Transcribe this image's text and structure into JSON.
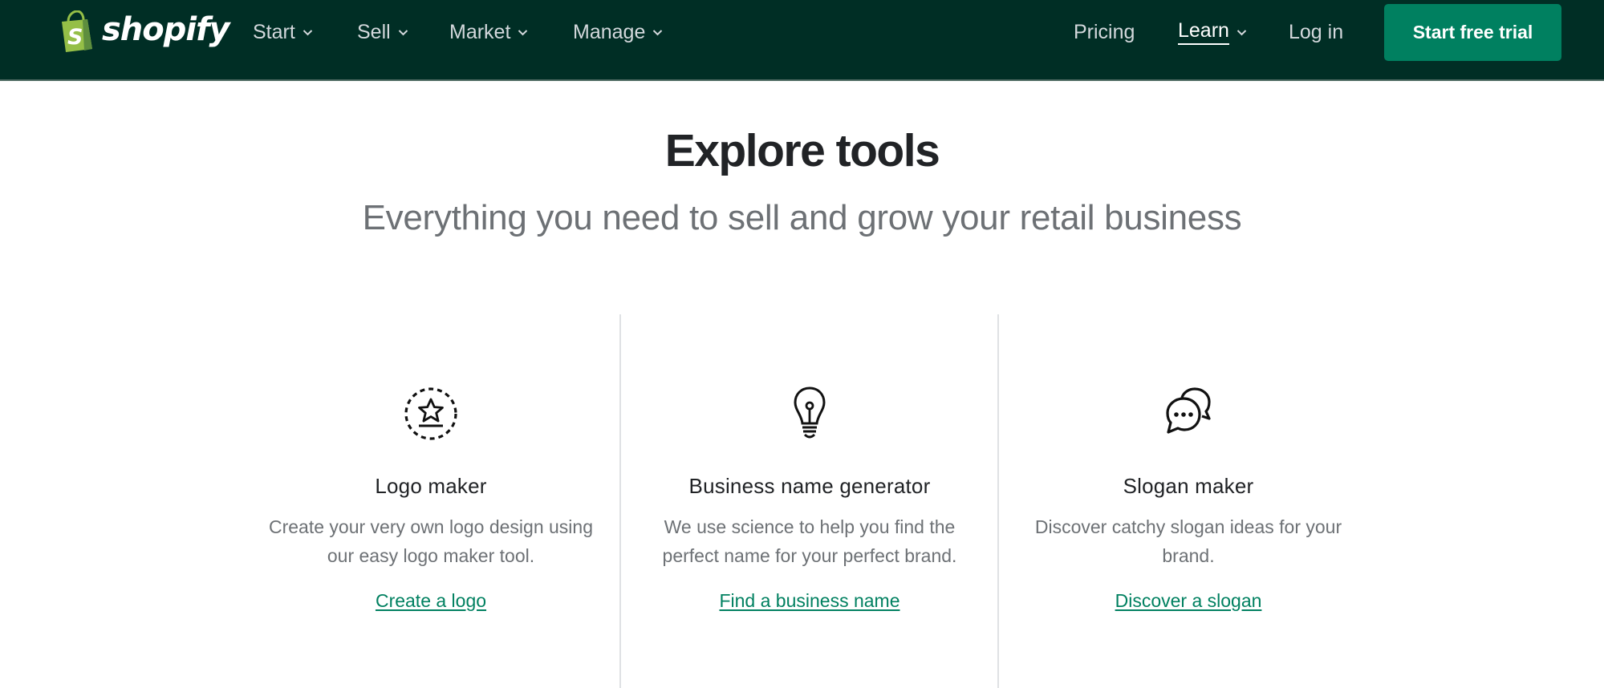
{
  "header": {
    "brand": "shopify",
    "nav_left": [
      {
        "label": "Start",
        "has_dropdown": true
      },
      {
        "label": "Sell",
        "has_dropdown": true
      },
      {
        "label": "Market",
        "has_dropdown": true
      },
      {
        "label": "Manage",
        "has_dropdown": true
      }
    ],
    "nav_right": [
      {
        "label": "Pricing",
        "has_dropdown": false
      },
      {
        "label": "Learn",
        "has_dropdown": true,
        "active": true
      },
      {
        "label": "Log in",
        "has_dropdown": false
      }
    ],
    "cta_label": "Start free trial"
  },
  "main": {
    "title": "Explore tools",
    "subtitle": "Everything you need to sell and grow your retail business",
    "tools": [
      {
        "icon": "logo-star-icon",
        "name": "Logo maker",
        "description": "Create your very own logo design using our easy logo maker tool.",
        "link": "Create a logo"
      },
      {
        "icon": "lightbulb-icon",
        "name": "Business name generator",
        "description": "We use science to help you find the perfect name for your perfect brand.",
        "link": "Find a business name"
      },
      {
        "icon": "chat-bubbles-icon",
        "name": "Slogan maker",
        "description": "Discover catchy slogan ideas for your brand.",
        "link": "Discover a slogan"
      }
    ]
  },
  "colors": {
    "header_bg": "#002e25",
    "accent": "#008060",
    "heading": "#212326",
    "muted": "#6d7175",
    "divider": "#dfe1e4"
  }
}
